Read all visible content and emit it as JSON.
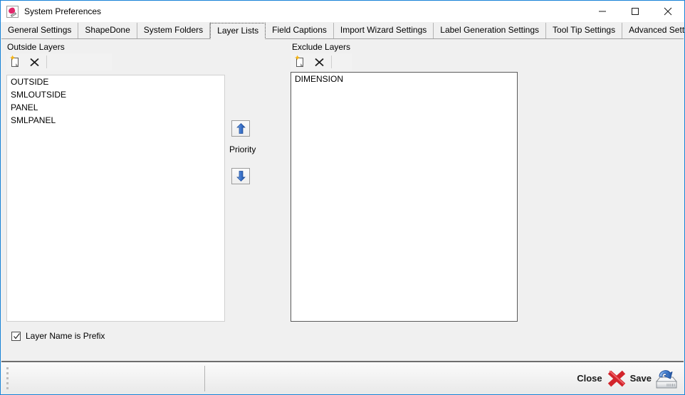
{
  "window": {
    "title": "System Preferences",
    "icon": "app-palette-icon",
    "controls": {
      "minimize": "minimize-icon",
      "maximize": "maximize-icon",
      "close": "close-icon"
    }
  },
  "tabs": [
    {
      "label": "General Settings",
      "selected": false
    },
    {
      "label": "ShapeDone",
      "selected": false
    },
    {
      "label": "System Folders",
      "selected": false
    },
    {
      "label": "Layer Lists",
      "selected": true
    },
    {
      "label": "Field Captions",
      "selected": false
    },
    {
      "label": "Import Wizard Settings",
      "selected": false
    },
    {
      "label": "Label Generation Settings",
      "selected": false
    },
    {
      "label": "Tool Tip Settings",
      "selected": false
    },
    {
      "label": "Advanced Settings",
      "selected": false
    }
  ],
  "outside_panel": {
    "label": "Outside Layers",
    "toolbar": {
      "new_icon": "new-document-icon",
      "delete_icon": "delete-x-icon"
    },
    "items": [
      "OUTSIDE",
      "SMLOUTSIDE",
      "PANEL",
      "SMLPANEL"
    ]
  },
  "exclude_panel": {
    "label": "Exclude Layers",
    "toolbar": {
      "new_icon": "new-document-icon",
      "delete_icon": "delete-x-icon"
    },
    "items": [
      "DIMENSION"
    ]
  },
  "priority": {
    "label": "Priority",
    "up_icon": "arrow-up-icon",
    "down_icon": "arrow-down-icon"
  },
  "options": {
    "layer_name_is_prefix": {
      "label": "Layer Name is Prefix",
      "checked": true
    }
  },
  "footer": {
    "close_label": "Close",
    "close_icon": "red-x-icon",
    "save_label": "Save",
    "save_icon": "save-disk-icon"
  },
  "colors": {
    "window_border": "#1883d7",
    "dialog_face": "#f0f0f0",
    "accent_arrow": "#2f6fd0",
    "close_red": "#d3242b",
    "new_star": "#f6b516"
  }
}
